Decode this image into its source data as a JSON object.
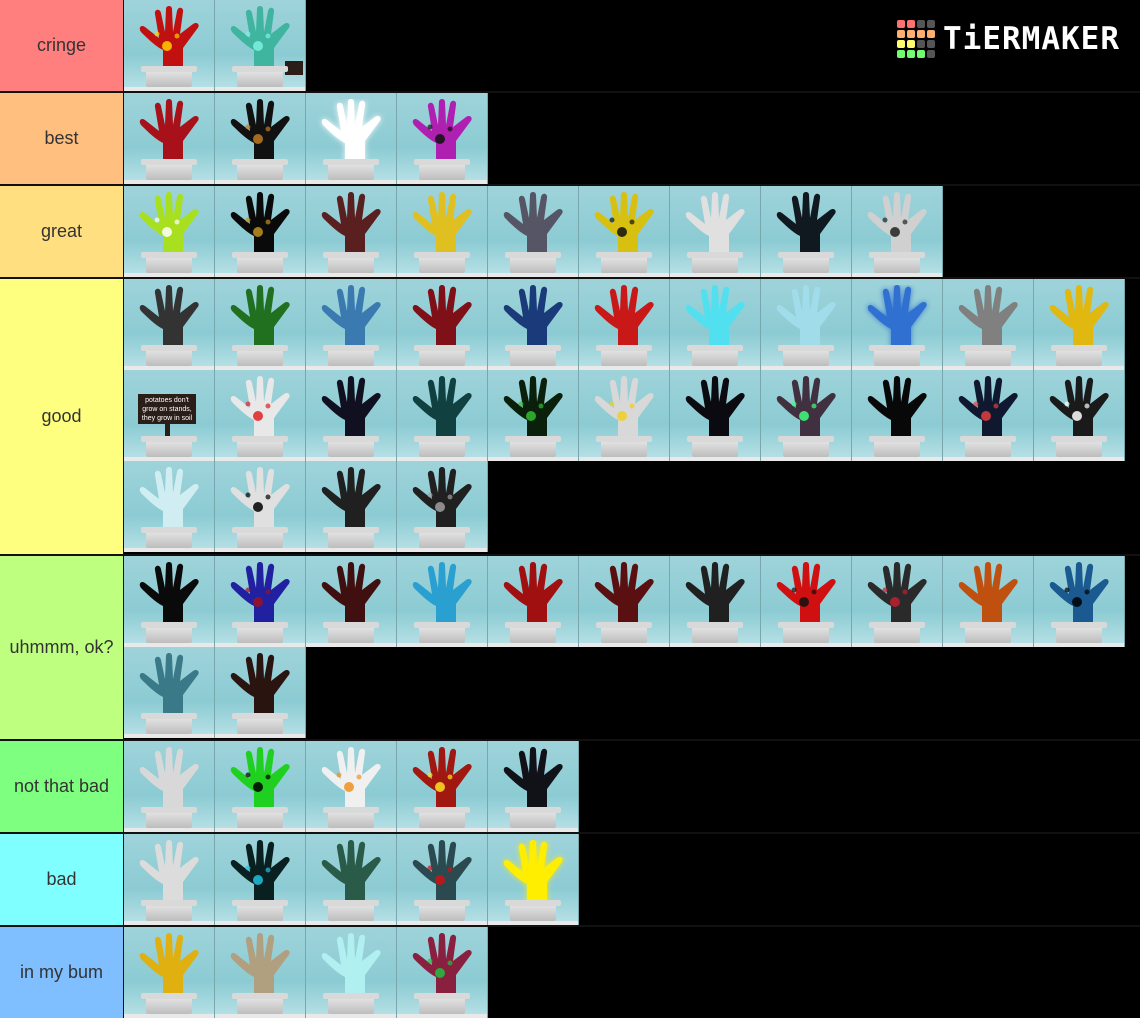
{
  "logo": {
    "text": "TiERMAKER",
    "grid_colors": [
      "#ff7070",
      "#ff7070",
      "#555555",
      "#555555",
      "#ffb070",
      "#ffb070",
      "#ffb070",
      "#ffb070",
      "#ffff70",
      "#ffff70",
      "#555555",
      "#555555",
      "#70ff70",
      "#70ff70",
      "#70ff70",
      "#555555"
    ]
  },
  "tiers": [
    {
      "label": "cringe",
      "color": "#ff7f7f",
      "items": [
        {
          "name": "red-flaming-glove",
          "fill": "#c01010",
          "accent": "#ffd000"
        },
        {
          "name": "teal-glove",
          "fill": "#3fb5a0",
          "accent": "#7ff0e0",
          "sign": true
        }
      ]
    },
    {
      "label": "best",
      "color": "#ffbf7f",
      "items": [
        {
          "name": "red-glove",
          "fill": "#a8101a"
        },
        {
          "name": "black-swirl-glove",
          "fill": "#111111",
          "accent": "#c07a20"
        },
        {
          "name": "glowing-white-glove",
          "fill": "#ffffff",
          "glow": true
        },
        {
          "name": "purple-checker-glove",
          "fill": "#b020b0",
          "accent": "#111111"
        }
      ]
    },
    {
      "label": "great",
      "color": "#ffdf7f",
      "items": [
        {
          "name": "lime-dream-glove",
          "fill": "#a8e020",
          "accent": "#ffffff"
        },
        {
          "name": "black-smile-glove",
          "fill": "#0a0a0a",
          "accent": "#c09020"
        },
        {
          "name": "brick-glove",
          "fill": "#5a2020"
        },
        {
          "name": "yellow-face-glove",
          "fill": "#e0c020"
        },
        {
          "name": "dotted-grey-glove",
          "fill": "#555566"
        },
        {
          "name": "hazard-stripe-glove",
          "fill": "#d8c010",
          "accent": "#111111"
        },
        {
          "name": "white-glove",
          "fill": "#e0e0e0"
        },
        {
          "name": "black-pattern-glove",
          "fill": "#101820"
        },
        {
          "name": "black-white-splat-glove",
          "fill": "#d0d0d0",
          "accent": "#222222"
        }
      ]
    },
    {
      "label": "good",
      "color": "#ffff7f",
      "items": [
        {
          "name": "dark-grey-glove",
          "fill": "#333333"
        },
        {
          "name": "green-pattern-glove",
          "fill": "#207020"
        },
        {
          "name": "blue-glove",
          "fill": "#3a7ab0"
        },
        {
          "name": "dark-red-candy-glove",
          "fill": "#801018"
        },
        {
          "name": "blue-crackle-glove",
          "fill": "#1a3a7a"
        },
        {
          "name": "red-pattern-glove",
          "fill": "#c81818"
        },
        {
          "name": "cyan-glow-glove",
          "fill": "#50e0f0"
        },
        {
          "name": "ghost-blue-glove",
          "fill": "#a0dcea"
        },
        {
          "name": "electric-blue-glove",
          "fill": "#3070d0",
          "glow": true
        },
        {
          "name": "grey-glove",
          "fill": "#808080"
        },
        {
          "name": "yellow-dotted-glove",
          "fill": "#e0b810"
        },
        {
          "name": "potato-sign",
          "fill": "none",
          "sign": true,
          "sign_text": "potatoes don't grow on stands, they grow in soil"
        },
        {
          "name": "white-red-outline-glove",
          "fill": "#e8e8e8",
          "accent": "#e02020"
        },
        {
          "name": "dark-shadow-glove",
          "fill": "#101020"
        },
        {
          "name": "teal-pattern-glove",
          "fill": "#104040"
        },
        {
          "name": "green-matrix-glove",
          "fill": "#0a200a",
          "accent": "#30c030"
        },
        {
          "name": "cat-white-glove",
          "fill": "#d8d8d8",
          "accent": "#f0d020"
        },
        {
          "name": "black-glove",
          "fill": "#0a0a10"
        },
        {
          "name": "pumpkin-plant",
          "fill": "#403040",
          "accent": "#40ff80"
        },
        {
          "name": "black-glove-2",
          "fill": "#080808"
        },
        {
          "name": "navy-x-glove",
          "fill": "#101830",
          "accent": "#e04040"
        },
        {
          "name": "black-arrow-glove",
          "fill": "#1a1a1a",
          "accent": "#ffffff"
        },
        {
          "name": "transparent-glove",
          "fill": "#d0eef2"
        },
        {
          "name": "smiley-white-glove",
          "fill": "#e0e0e0",
          "accent": "#000000"
        },
        {
          "name": "dark-gradient-scene",
          "fill": "#202020"
        },
        {
          "name": "black-camo-glove",
          "fill": "#202020",
          "accent": "#a0a0a0"
        }
      ]
    },
    {
      "label": "uhmmm, ok?",
      "color": "#bfff7f",
      "items": [
        {
          "name": "black-z-glove",
          "fill": "#0a0a0a"
        },
        {
          "name": "blue-red-target-glove",
          "fill": "#2020a0",
          "accent": "#a01020"
        },
        {
          "name": "dark-red-glove",
          "fill": "#401010"
        },
        {
          "name": "light-blue-glove",
          "fill": "#2aa0d0"
        },
        {
          "name": "red-marble-glove",
          "fill": "#a01010"
        },
        {
          "name": "maroon-glove",
          "fill": "#5a1010"
        },
        {
          "name": "dark-noise-glove",
          "fill": "#202020"
        },
        {
          "name": "red-brick-glove",
          "fill": "#d01010",
          "accent": "#111111"
        },
        {
          "name": "red-black-mech-glove",
          "fill": "#2a2a2a",
          "accent": "#c02030"
        },
        {
          "name": "orange-glove",
          "fill": "#c05010"
        },
        {
          "name": "blue-smile-glove",
          "fill": "#1a5a90",
          "accent": "#000000"
        },
        {
          "name": "steel-blue-glove",
          "fill": "#3a7a88"
        },
        {
          "name": "dark-brown-glove",
          "fill": "#2a1410"
        }
      ]
    },
    {
      "label": "not that bad",
      "color": "#7fff7f",
      "items": [
        {
          "name": "plain-white-glove",
          "fill": "#d8d8d8"
        },
        {
          "name": "green-biohazard-glove",
          "fill": "#20d020",
          "accent": "#000000"
        },
        {
          "name": "adios-glove",
          "fill": "#f0f0f0",
          "accent": "#f09020"
        },
        {
          "name": "lightning-red-glove",
          "fill": "#a01810",
          "accent": "#ffe020"
        },
        {
          "name": "black-mesh-glove",
          "fill": "#111118"
        }
      ]
    },
    {
      "label": "bad",
      "color": "#7fffff",
      "items": [
        {
          "name": "white-glove-2",
          "fill": "#dcdcdc"
        },
        {
          "name": "cyan-ring-glove",
          "fill": "#0a2020",
          "accent": "#20c0e0"
        },
        {
          "name": "green-marble-glove",
          "fill": "#2a5a48"
        },
        {
          "name": "dark-teal-hole-glove",
          "fill": "#2a4a50",
          "accent": "#d01010"
        },
        {
          "name": "bright-yellow-glove",
          "fill": "#ffee00",
          "glow": true
        }
      ]
    },
    {
      "label": "in my bum",
      "color": "#7fbfff",
      "items": [
        {
          "name": "gold-glove",
          "fill": "#e0b010"
        },
        {
          "name": "striped-beige-glove",
          "fill": "#b0a080"
        },
        {
          "name": "ghost-teal-glove",
          "fill": "#b0f0f0"
        },
        {
          "name": "rainbow-pattern-glove",
          "fill": "#8a2040",
          "accent": "#20c040"
        }
      ]
    }
  ]
}
